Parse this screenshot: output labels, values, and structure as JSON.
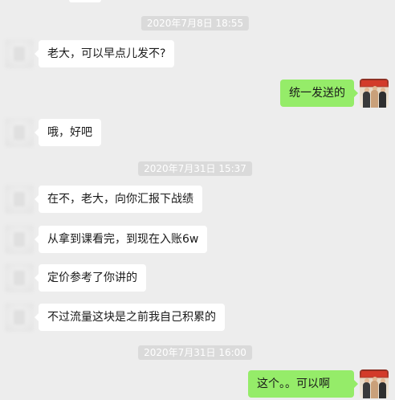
{
  "timestamps": [
    "2020年7月8日 18:55",
    "2020年7月31日 15:37",
    "2020年7月31日 16:00"
  ],
  "messages": [
    {
      "side": "incoming",
      "text": "老大，可以早点儿发不?"
    },
    {
      "side": "outgoing",
      "text": "统一发送的"
    },
    {
      "side": "incoming",
      "text": "哦，好吧"
    },
    {
      "side": "incoming",
      "text": "在不，老大，向你汇报下战绩"
    },
    {
      "side": "incoming",
      "text": "从拿到课看完，到现在入账6w"
    },
    {
      "side": "incoming",
      "text": "定价参考了你讲的"
    },
    {
      "side": "incoming",
      "text": "不过流量这块是之前我自己积累的"
    },
    {
      "side": "outgoing",
      "text": "这个。。可以啊"
    }
  ],
  "colors": {
    "background": "#ededed",
    "incoming_bubble": "#ffffff",
    "outgoing_bubble": "#95ec69",
    "timestamp_pill": "#dadada"
  }
}
